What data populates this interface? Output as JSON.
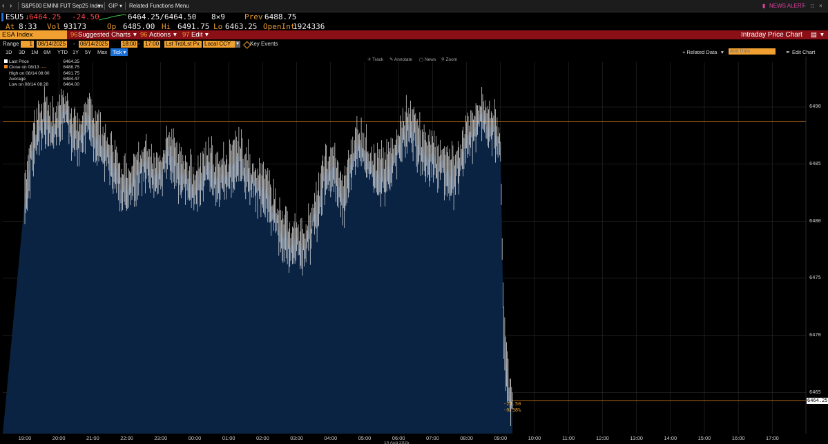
{
  "topbar": {
    "ticker_title": "S&P500 EMINI FUT Sep25 Index",
    "gip": "GIP",
    "related": "Related Functions Menu",
    "news_alert": "NEWS ALERT"
  },
  "quote": {
    "symbol": "ESU5",
    "last": "6464.25",
    "change": "-24.50",
    "bidask": "6464.25/6464.50",
    "size": "8×9",
    "prev_label": "Prev",
    "prev": "6488.75",
    "at_label": "At",
    "at": "8:33",
    "vol_label": "Vol",
    "vol": "93173",
    "op_label": "Op",
    "op": "6485.00",
    "hi_label": "Hi",
    "hi": "6491.75",
    "lo_label": "Lo",
    "lo": "6463.25",
    "oi_label": "OpenInt",
    "oi": "1924336"
  },
  "toolbar": {
    "index_name": "ESA Index",
    "suggested": "Suggested Charts",
    "actions": "Actions",
    "edit": "Edit",
    "chart_title": "Intraday Price Chart"
  },
  "range": {
    "label": "Range",
    "period": "1",
    "start_date": "08/14/2025",
    "end_date": "08/14/2025",
    "start_time": "18:00",
    "end_time": "17:00",
    "price_type": "Lst Trd/Lst Px",
    "currency": "Local CCY",
    "key_events": "Key Events"
  },
  "periods": [
    "1D",
    "3D",
    "1M",
    "6M",
    "YTD",
    "1Y",
    "5Y",
    "Max"
  ],
  "period_selected": "Tick",
  "right_tools": {
    "related_data": "+ Related Data",
    "add_data_placeholder": "Add Data",
    "edit_chart": "Edit Chart"
  },
  "chart_tools": [
    "Track",
    "Annotate",
    "News",
    "Zoom"
  ],
  "legend": [
    {
      "label": "Last Price",
      "value": "6464.25"
    },
    {
      "label": "Close on 08/13",
      "value": "6488.75"
    },
    {
      "label": "High on 08/14 08:00",
      "value": "6491.75"
    },
    {
      "label": "Average",
      "value": "6484.47"
    },
    {
      "label": "Low on 08/14 08:28",
      "value": "6464.00"
    }
  ],
  "change_annotation": {
    "abs": "-24.50",
    "pct": "-0.38%"
  },
  "last_price_tag": "6464.25",
  "date_label": "14 Aug 2025",
  "colors": {
    "area": "#0a2342",
    "price_line": "#e8e8e8",
    "ref_line": "#e8871e",
    "bar": "#8b0f16"
  },
  "chart_data": {
    "type": "area",
    "x_ticks": [
      "19:00",
      "20:00",
      "21:00",
      "22:00",
      "23:00",
      "00:00",
      "01:00",
      "02:00",
      "03:00",
      "04:00",
      "05:00",
      "06:00",
      "07:00",
      "08:00",
      "09:00",
      "10:00",
      "11:00",
      "12:00",
      "13:00",
      "14:00",
      "15:00",
      "16:00",
      "17:00"
    ],
    "y_ticks": [
      6465,
      6470,
      6475,
      6480,
      6485,
      6490
    ],
    "ylim": [
      6462,
      6492
    ],
    "prev_close": 6488.75,
    "last_price": 6464.25,
    "grid": true,
    "series": [
      {
        "x_hours": [
          0,
          0.2,
          0.4,
          0.6,
          0.8,
          1.0,
          1.2,
          1.4,
          1.6,
          1.8,
          2.0,
          2.2,
          2.4,
          2.6,
          2.8,
          3.0,
          3.2,
          3.4,
          3.6,
          3.8,
          4.0,
          4.2,
          4.4,
          4.6,
          4.8,
          5.0,
          5.2,
          5.4,
          5.6,
          5.8,
          6.0,
          6.2,
          6.4,
          6.6,
          6.8,
          7.0,
          7.2,
          7.4,
          7.6,
          7.8,
          8.0,
          8.2,
          8.4,
          8.6,
          8.8,
          9.0,
          9.2,
          9.4,
          9.6,
          9.8,
          10.0,
          10.2,
          10.4,
          10.6,
          10.8,
          11.0,
          11.2,
          11.4,
          11.6,
          11.8,
          12.0,
          12.2,
          12.4,
          12.6,
          12.8,
          13.0,
          13.2,
          13.4,
          13.6,
          13.8,
          14.0,
          14.1,
          14.2,
          14.25,
          14.3,
          14.35
        ],
        "values": [
          6482,
          6486,
          6488.5,
          6489,
          6488,
          6489,
          6490,
          6488,
          6487,
          6489,
          6488,
          6487,
          6486,
          6485,
          6483.5,
          6483,
          6484,
          6485,
          6485,
          6484.5,
          6484,
          6486,
          6485,
          6484,
          6483.5,
          6483,
          6484,
          6485,
          6484,
          6484,
          6484.5,
          6485.5,
          6485,
          6484,
          6483,
          6483,
          6482,
          6480,
          6479,
          6478,
          6478.5,
          6478,
          6479,
          6481,
          6484,
          6485,
          6484,
          6482,
          6485,
          6487,
          6486,
          6485,
          6484,
          6484,
          6485,
          6487,
          6488,
          6488.5,
          6487,
          6486,
          6485.5,
          6485,
          6484.5,
          6484,
          6485,
          6487,
          6488,
          6490,
          6489,
          6488,
          6486.5,
          6470,
          6466,
          6465,
          6464,
          6464.25
        ]
      }
    ]
  }
}
